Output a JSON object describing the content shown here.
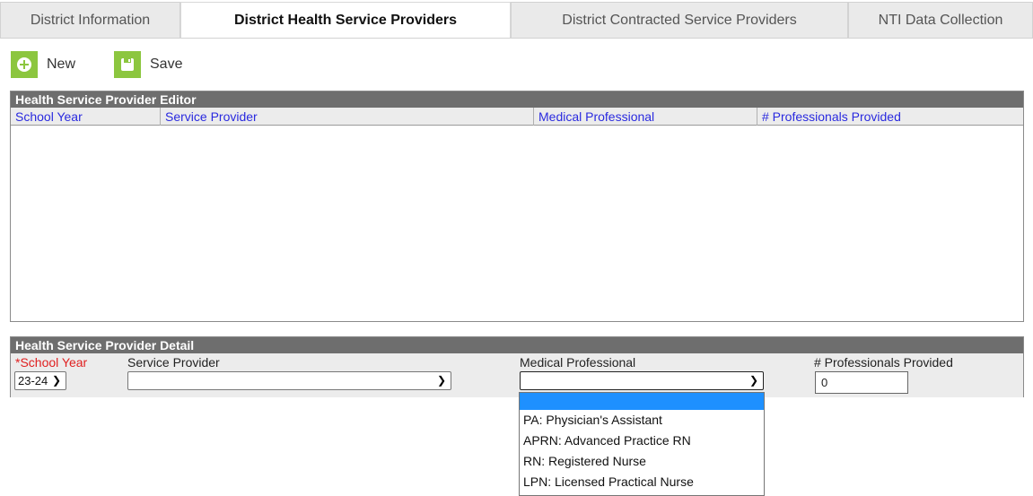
{
  "tabs": [
    {
      "label": "District Information"
    },
    {
      "label": "District Health Service Providers"
    },
    {
      "label": "District Contracted Service Providers"
    },
    {
      "label": "NTI Data Collection"
    }
  ],
  "toolbar": {
    "new_label": "New",
    "save_label": "Save"
  },
  "editor": {
    "title": "Health Service Provider Editor",
    "columns": [
      "School Year",
      "Service Provider",
      "Medical Professional",
      "# Professionals Provided"
    ]
  },
  "detail": {
    "title": "Health Service Provider Detail",
    "school_year_label": "*School Year",
    "school_year_value": "23-24",
    "service_provider_label": "Service Provider",
    "service_provider_value": "",
    "medical_professional_label": "Medical Professional",
    "medical_professional_value": "",
    "professionals_label": "# Professionals Provided",
    "professionals_value": "0"
  },
  "dropdown": {
    "options": [
      "",
      "PA: Physician's Assistant",
      "APRN: Advanced Practice RN",
      "RN: Registered Nurse",
      "LPN: Licensed Practical Nurse"
    ],
    "highlighted_index": 0
  },
  "icons": {
    "new": "plus-circle-icon",
    "save": "floppy-disk-icon"
  },
  "colors": {
    "accent_green": "#8cc63f",
    "header_gray": "#6e6e6e",
    "link_blue": "#2a2adf",
    "required_red": "#e02020",
    "highlight_blue": "#1e90ff"
  }
}
